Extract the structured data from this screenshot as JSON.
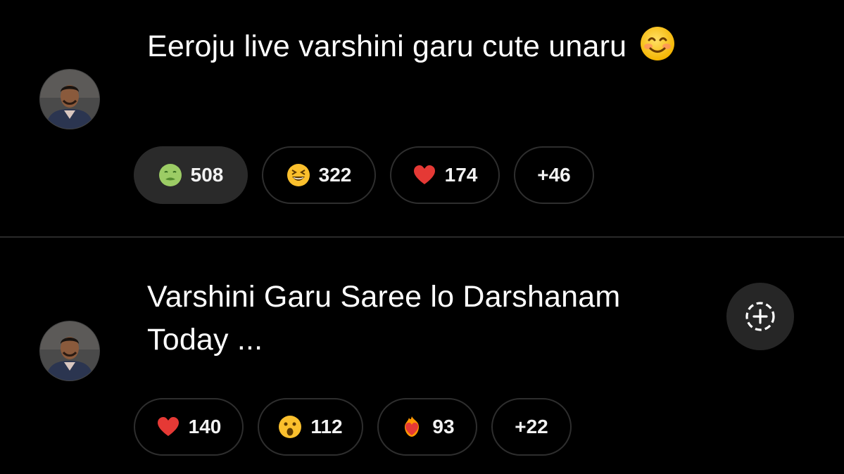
{
  "posts": [
    {
      "text": "Eeroju live varshini garu cute unaru",
      "inline_emoji": "smiling-face-icon",
      "reactions": [
        {
          "emoji": "nauseated-face-icon",
          "count": "508",
          "active": true
        },
        {
          "emoji": "grinning-squinting-face-icon",
          "count": "322",
          "active": false
        },
        {
          "emoji": "red-heart-icon",
          "count": "174",
          "active": false
        }
      ],
      "more": "+46"
    },
    {
      "text": "Varshini Garu Saree lo Darshanam Today ...",
      "reactions": [
        {
          "emoji": "red-heart-icon",
          "count": "140",
          "active": false
        },
        {
          "emoji": "astonished-face-icon",
          "count": "112",
          "active": false
        },
        {
          "emoji": "heart-on-fire-icon",
          "count": "93",
          "active": false
        }
      ],
      "more": "+22",
      "add_reaction_icon": "add-reaction-icon"
    }
  ],
  "colors": {
    "background": "#000000",
    "text": "#ffffff",
    "chip_border": "#2e2e2e",
    "chip_active": "#2a2a2a",
    "divider": "#2a2a2a"
  }
}
